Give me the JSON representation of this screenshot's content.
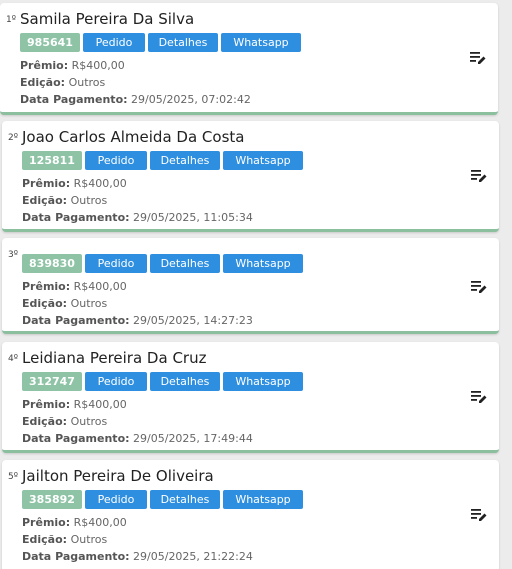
{
  "items": [
    {
      "rank": "1º",
      "name": "Samila Pereira Da Silva",
      "ticket": "985641",
      "btn_pedido": "Pedido",
      "btn_detalhes": "Detalhes",
      "btn_whatsapp": "Whatsapp",
      "premio_label": "Prêmio:",
      "premio_value": "R$400,00",
      "edicao_label": "Edição:",
      "edicao_value": "Outros",
      "pagamento_label": "Data Pagamento:",
      "pagamento_value": "29/05/2025, 07:02:42"
    },
    {
      "rank": "2º",
      "name": "Joao Carlos Almeida Da Costa",
      "ticket": "125811",
      "btn_pedido": "Pedido",
      "btn_detalhes": "Detalhes",
      "btn_whatsapp": "Whatsapp",
      "premio_label": "Prêmio:",
      "premio_value": "R$400,00",
      "edicao_label": "Edição:",
      "edicao_value": "Outros",
      "pagamento_label": "Data Pagamento:",
      "pagamento_value": "29/05/2025, 11:05:34"
    },
    {
      "rank": "3º",
      "name": "",
      "ticket": "839830",
      "btn_pedido": "Pedido",
      "btn_detalhes": "Detalhes",
      "btn_whatsapp": "Whatsapp",
      "premio_label": "Prêmio:",
      "premio_value": "R$400,00",
      "edicao_label": "Edição:",
      "edicao_value": "Outros",
      "pagamento_label": "Data Pagamento:",
      "pagamento_value": "29/05/2025, 14:27:23"
    },
    {
      "rank": "4º",
      "name": "Leidiana Pereira Da Cruz",
      "ticket": "312747",
      "btn_pedido": "Pedido",
      "btn_detalhes": "Detalhes",
      "btn_whatsapp": "Whatsapp",
      "premio_label": "Prêmio:",
      "premio_value": "R$400,00",
      "edicao_label": "Edição:",
      "edicao_value": "Outros",
      "pagamento_label": "Data Pagamento:",
      "pagamento_value": "29/05/2025, 17:49:44"
    },
    {
      "rank": "5º",
      "name": "Jailton Pereira De Oliveira",
      "ticket": "385892",
      "btn_pedido": "Pedido",
      "btn_detalhes": "Detalhes",
      "btn_whatsapp": "Whatsapp",
      "premio_label": "Prêmio:",
      "premio_value": "R$400,00",
      "edicao_label": "Edição:",
      "edicao_value": "Outros",
      "pagamento_label": "Data Pagamento:",
      "pagamento_value": "29/05/2025, 21:22:24"
    }
  ],
  "icons": {
    "edit": "playlist-edit-icon"
  },
  "colors": {
    "ticket_badge": "#8ec3a6",
    "action_button": "#2e8fe0",
    "card_accent": "#8bbf9e"
  }
}
